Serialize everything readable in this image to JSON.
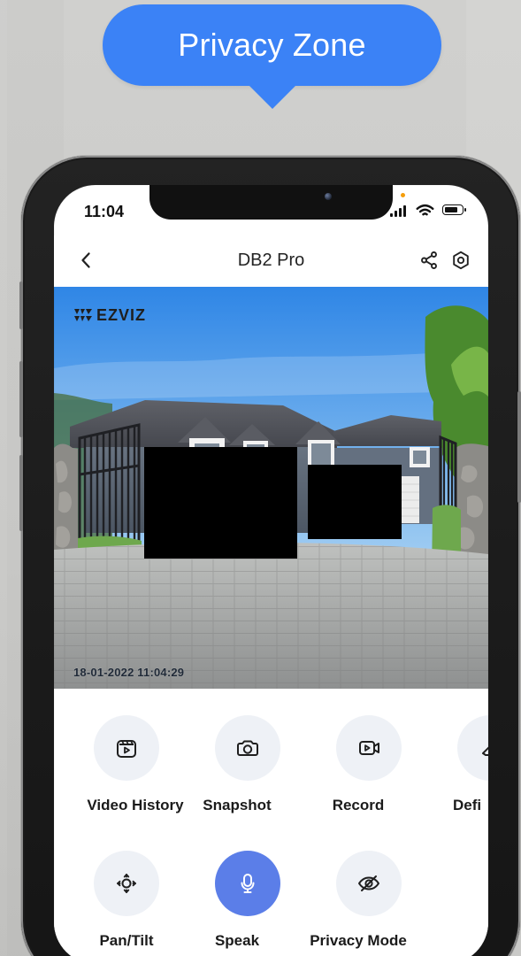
{
  "tooltip": {
    "label": "Privacy Zone"
  },
  "status_bar": {
    "time": "11:04"
  },
  "header": {
    "title": "DB2 Pro"
  },
  "camera": {
    "brand": "EZVIZ",
    "timestamp": "18-01-2022 11:04:29"
  },
  "controls": {
    "row1": [
      {
        "label": "Video History",
        "icon": "video-history-icon"
      },
      {
        "label": "Snapshot",
        "icon": "camera-icon"
      },
      {
        "label": "Record",
        "icon": "record-icon"
      },
      {
        "label": "Defi",
        "icon": "eraser-icon"
      }
    ],
    "row2": [
      {
        "label": "Pan/Tilt",
        "icon": "pan-tilt-icon"
      },
      {
        "label": "Speak",
        "icon": "microphone-icon"
      },
      {
        "label": "Privacy Mode",
        "icon": "eye-off-icon"
      }
    ]
  },
  "colors": {
    "accent": "#3b82f6",
    "active_control": "#5b7ee8",
    "control_bg": "#eef1f6",
    "text_primary": "#1b1b1b",
    "status_dot": "#f59e0b"
  }
}
